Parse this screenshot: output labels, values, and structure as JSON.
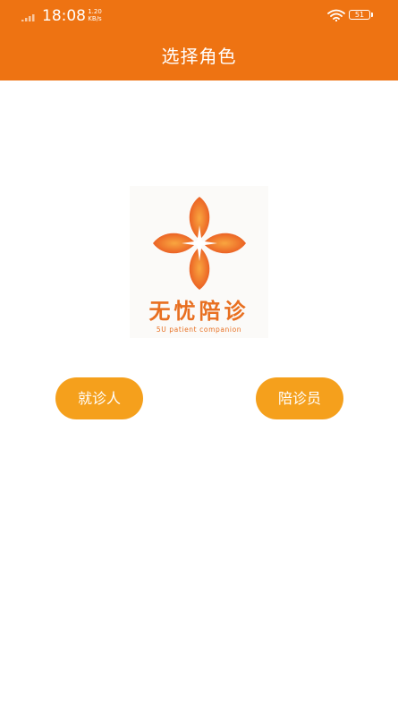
{
  "status_bar": {
    "time": "18:08",
    "net_speed_value": "1.20",
    "net_speed_unit": "KB/s",
    "battery": "51"
  },
  "header": {
    "title": "选择角色"
  },
  "logo": {
    "name": "无忧陪诊",
    "tagline": "5U patient companion"
  },
  "roles": {
    "patient_label": "就诊人",
    "companion_label": "陪诊员"
  },
  "colors": {
    "header": "#EE7312",
    "button": "#F5A01C",
    "brand": "#E86F20"
  },
  "icons": {
    "signal": "signal-icon",
    "wifi": "wifi-icon",
    "battery": "battery-icon",
    "logo": "four-petal-logo-icon"
  }
}
